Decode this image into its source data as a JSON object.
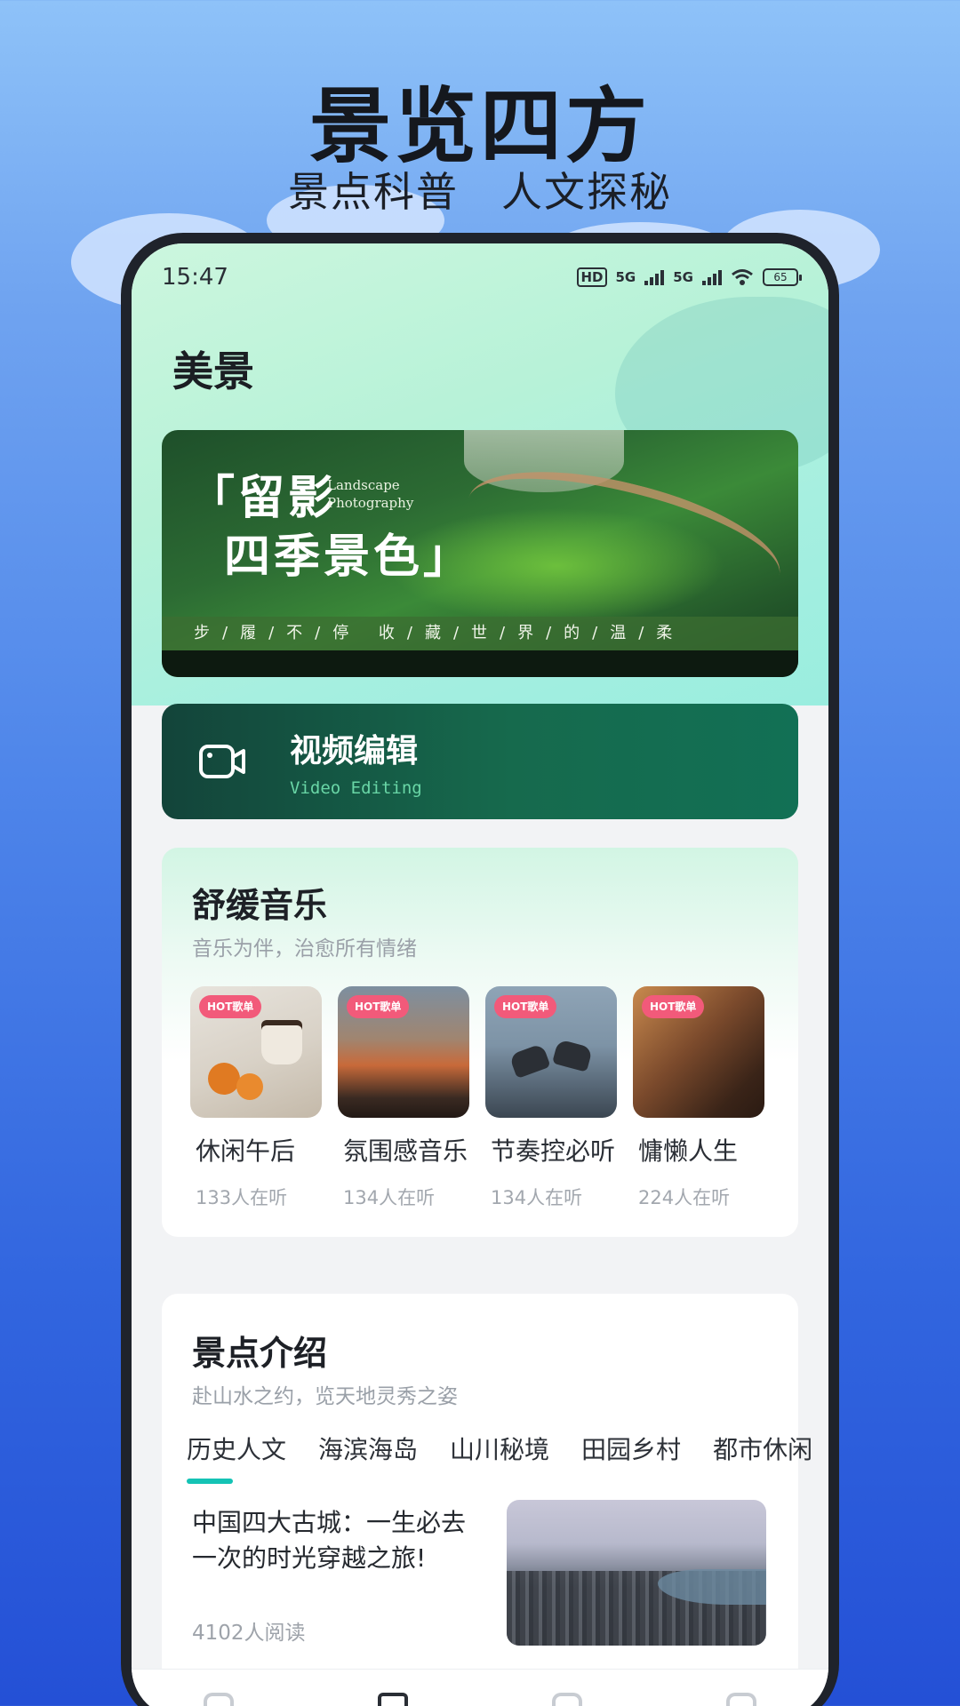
{
  "promo": {
    "title": "景览四方",
    "subtitle": "景点科普　人文探秘"
  },
  "status_bar": {
    "time": "15:47",
    "hd": "HD",
    "network1": "5G",
    "network2": "5G",
    "battery": "65"
  },
  "page": {
    "title": "美景"
  },
  "banner": {
    "title_line1": "「留影",
    "title_line2": "四季景色」",
    "english": "Landscape Photography",
    "tagline": "步/履/不/停 收/藏/世/界/的/温/柔"
  },
  "video_card": {
    "title": "视频编辑",
    "subtitle": "Video Editing",
    "icon": "video-camera-icon"
  },
  "music": {
    "title": "舒缓音乐",
    "subtitle": "音乐为伴，治愈所有情绪",
    "badge": "HOT歌单",
    "playlists": [
      {
        "name": "休闲午后",
        "listeners": "133人在听"
      },
      {
        "name": "氛围感音乐",
        "listeners": "134人在听"
      },
      {
        "name": "节奏控必听",
        "listeners": "134人在听"
      },
      {
        "name": "慵懒人生",
        "listeners": "224人在听"
      }
    ]
  },
  "spots": {
    "title": "景点介绍",
    "subtitle": "赴山水之约，览天地灵秀之姿",
    "tabs": [
      "历史人文",
      "海滨海岛",
      "山川秘境",
      "田园乡村",
      "都市休闲"
    ],
    "active_tab": "历史人文",
    "article": {
      "title": "中国四大古城：一生必去一次的时光穿越之旅!",
      "reads": "4102人阅读"
    }
  },
  "colors": {
    "accent": "#14c3b5",
    "video_card": "#166a4d",
    "hot_badge": "#f25a7a"
  }
}
